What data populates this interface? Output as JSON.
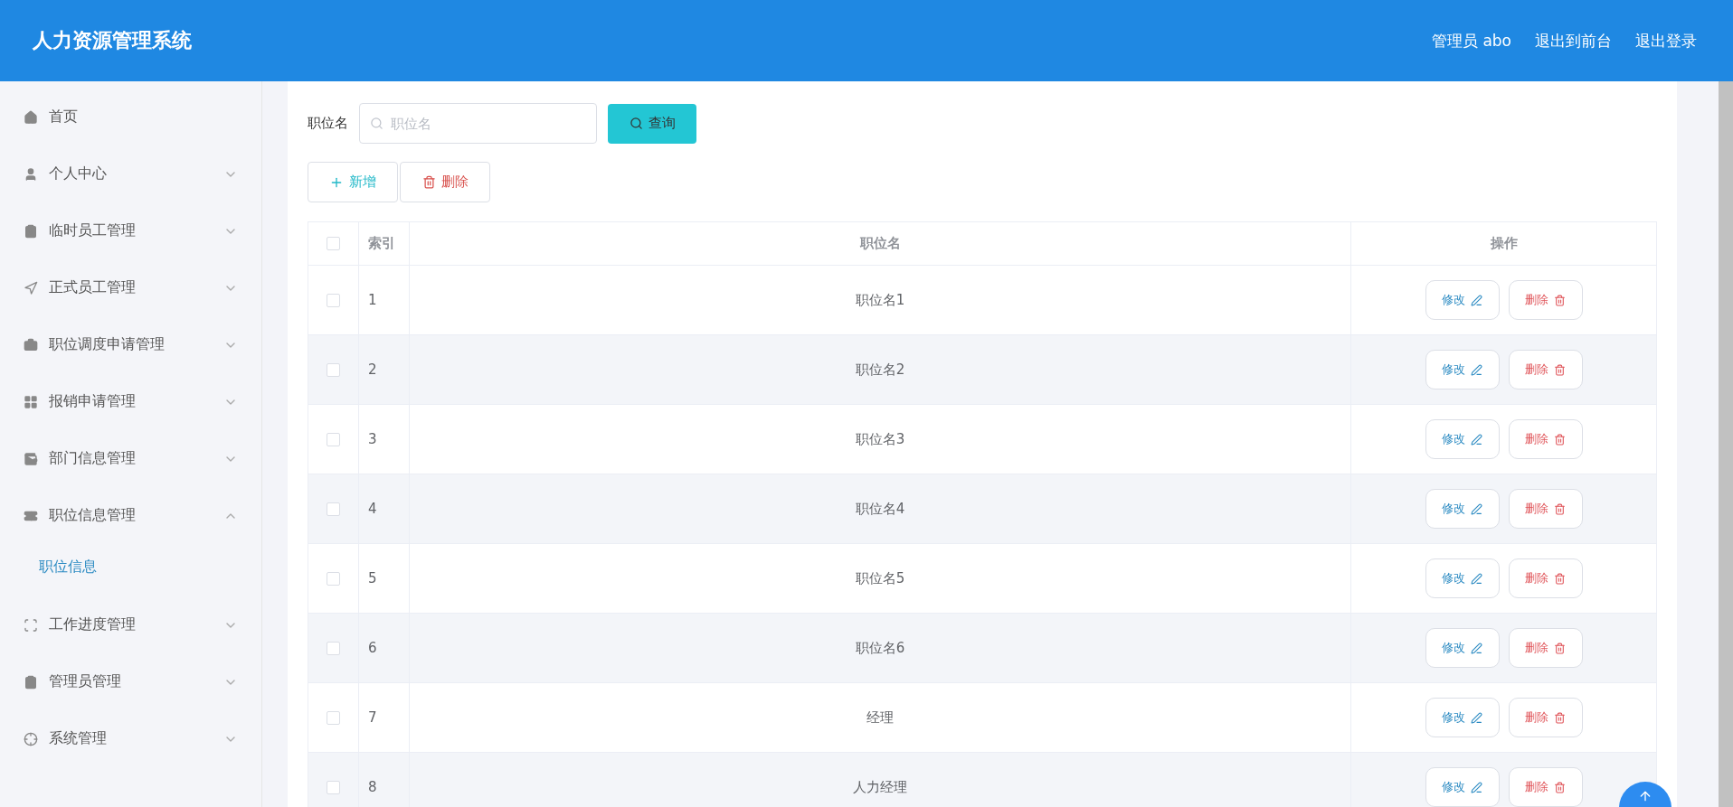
{
  "header": {
    "title": "人力资源管理系统",
    "links": [
      "管理员 abo",
      "退出到前台",
      "退出登录"
    ]
  },
  "sidebar": {
    "items": [
      {
        "label": "首页",
        "kind": "link"
      },
      {
        "label": "个人中心",
        "kind": "menu",
        "expanded": false
      },
      {
        "label": "临时员工管理",
        "kind": "menu",
        "expanded": false
      },
      {
        "label": "正式员工管理",
        "kind": "menu",
        "expanded": false
      },
      {
        "label": "职位调度申请管理",
        "kind": "menu",
        "expanded": false
      },
      {
        "label": "报销申请管理",
        "kind": "menu",
        "expanded": false
      },
      {
        "label": "部门信息管理",
        "kind": "menu",
        "expanded": false
      },
      {
        "label": "职位信息管理",
        "kind": "menu",
        "expanded": true,
        "children": [
          {
            "label": "职位信息",
            "selected": true
          }
        ]
      },
      {
        "label": "工作进度管理",
        "kind": "menu",
        "expanded": false
      },
      {
        "label": "管理员管理",
        "kind": "menu",
        "expanded": false
      },
      {
        "label": "系统管理",
        "kind": "menu",
        "expanded": false
      }
    ]
  },
  "search": {
    "label": "职位名",
    "placeholder": "职位名",
    "button": "查询"
  },
  "actions": {
    "add": "新增",
    "delete": "删除"
  },
  "table": {
    "select_all_checked": false,
    "columns": [
      "索引",
      "职位名",
      "操作"
    ],
    "rows": [
      {
        "index": "1",
        "name": "职位名1",
        "checked": false,
        "edit": "修改",
        "delete": "删除"
      },
      {
        "index": "2",
        "name": "职位名2",
        "checked": false,
        "edit": "修改",
        "delete": "删除"
      },
      {
        "index": "3",
        "name": "职位名3",
        "checked": false,
        "edit": "修改",
        "delete": "删除"
      },
      {
        "index": "4",
        "name": "职位名4",
        "checked": false,
        "edit": "修改",
        "delete": "删除"
      },
      {
        "index": "5",
        "name": "职位名5",
        "checked": false,
        "edit": "修改",
        "delete": "删除"
      },
      {
        "index": "6",
        "name": "职位名6",
        "checked": false,
        "edit": "修改",
        "delete": "删除"
      },
      {
        "index": "7",
        "name": "经理",
        "checked": false,
        "edit": "修改",
        "delete": "删除"
      },
      {
        "index": "8",
        "name": "人力经理",
        "checked": false,
        "edit": "修改",
        "delete": "删除"
      }
    ]
  }
}
